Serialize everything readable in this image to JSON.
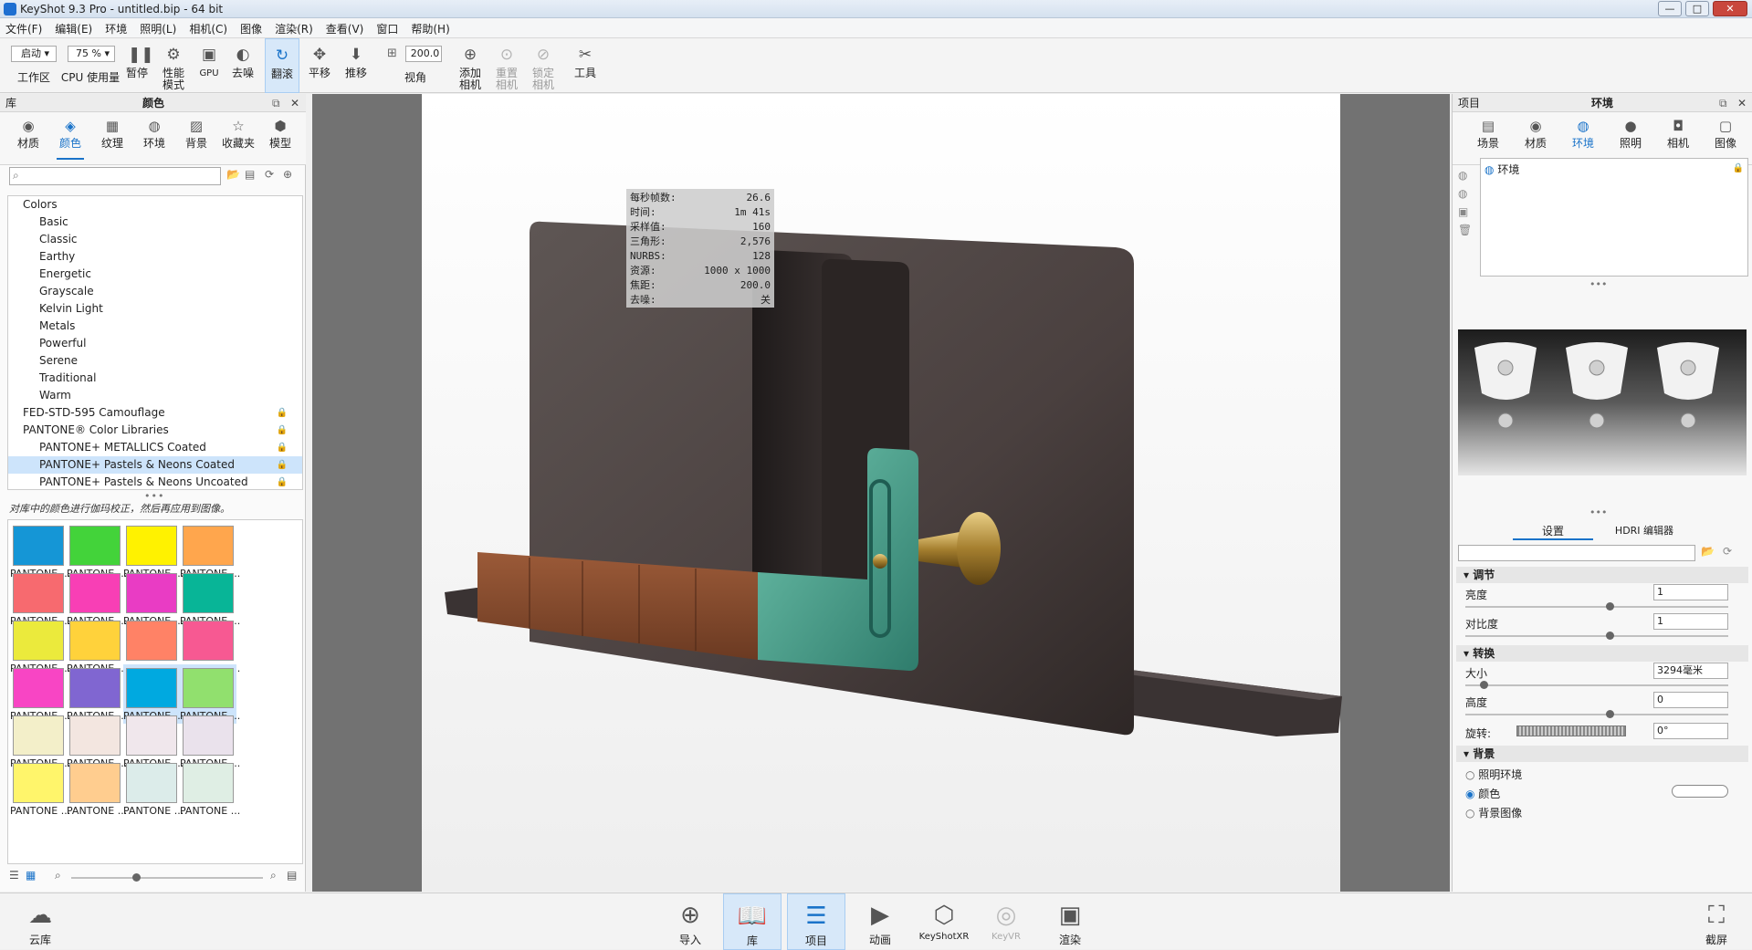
{
  "window": {
    "title": "KeyShot 9.3 Pro  - untitled.bip  - 64 bit",
    "min": "—",
    "max": "□",
    "close": "✕"
  },
  "menu": [
    "文件(F)",
    "编辑(E)",
    "环境",
    "照明(L)",
    "相机(C)",
    "图像",
    "渲染(R)",
    "查看(V)",
    "窗口",
    "帮助(H)"
  ],
  "toolbar": {
    "workspace_select": "启动",
    "workspace_label": "工作区",
    "cpu_select": "75 %",
    "cpu_label": "CPU 使用量",
    "pause": "暂停",
    "perf_mode": "性能\n模式",
    "gpu": "GPU",
    "denoise": "去噪",
    "tumble": "翻滚",
    "pan": "平移",
    "dolly": "推移",
    "fov_value": "200.0",
    "fov_label": "视角",
    "add_camera": "添加\n相机",
    "reset_camera": "重置\n相机",
    "lock_camera": "锁定\n相机",
    "tools": "工具"
  },
  "library": {
    "panel_label": "库",
    "panel_title": "颜色",
    "tabs": [
      "材质",
      "颜色",
      "纹理",
      "环境",
      "背景",
      "收藏夹",
      "模型"
    ],
    "active_tab": "颜色",
    "search_placeholder": "",
    "tree": [
      {
        "label": "Colors",
        "level": 0,
        "locked": false,
        "selected": false
      },
      {
        "label": "Basic",
        "level": 1,
        "locked": false,
        "selected": false
      },
      {
        "label": "Classic",
        "level": 1,
        "locked": false,
        "selected": false
      },
      {
        "label": "Earthy",
        "level": 1,
        "locked": false,
        "selected": false
      },
      {
        "label": "Energetic",
        "level": 1,
        "locked": false,
        "selected": false
      },
      {
        "label": "Grayscale",
        "level": 1,
        "locked": false,
        "selected": false
      },
      {
        "label": "Kelvin Light",
        "level": 1,
        "locked": false,
        "selected": false
      },
      {
        "label": "Metals",
        "level": 1,
        "locked": false,
        "selected": false
      },
      {
        "label": "Powerful",
        "level": 1,
        "locked": false,
        "selected": false
      },
      {
        "label": "Serene",
        "level": 1,
        "locked": false,
        "selected": false
      },
      {
        "label": "Traditional",
        "level": 1,
        "locked": false,
        "selected": false
      },
      {
        "label": "Warm",
        "level": 1,
        "locked": false,
        "selected": false
      },
      {
        "label": "FED-STD-595 Camouflage",
        "level": 0,
        "locked": true,
        "selected": false
      },
      {
        "label": "PANTONE® Color Libraries",
        "level": 0,
        "locked": true,
        "selected": false
      },
      {
        "label": "PANTONE+ METALLICS Coated",
        "level": 1,
        "locked": true,
        "selected": false
      },
      {
        "label": "PANTONE+ Pastels & Neons Coated",
        "level": 1,
        "locked": true,
        "selected": true
      },
      {
        "label": "PANTONE+ Pastels & Neons Uncoated",
        "level": 1,
        "locked": true,
        "selected": false
      }
    ],
    "hint": "对库中的颜色进行伽玛校正，然后再应用到图像。",
    "swatch_label": "PANTONE ...",
    "swatches": [
      "#1596d6",
      "#43d33a",
      "#fff200",
      "#ffa64d",
      "#f76a6f",
      "#f83fb5",
      "#e93cc4",
      "#08b597",
      "#ebea3c",
      "#ffd23b",
      "#ff8266",
      "#f75992",
      "#f845c4",
      "#8066d1",
      "#00a9e0",
      "#91e06e",
      "#f3efc9",
      "#f3e6e0",
      "#f0e7ec",
      "#eae2ec",
      "#fff56b",
      "#ffcd8f",
      "#dcecea",
      "#dfeee4"
    ],
    "selected_swatches": [
      14,
      15
    ]
  },
  "stats": [
    {
      "k": "每秒帧数:",
      "v": "26.6"
    },
    {
      "k": "时间:",
      "v": "1m 41s"
    },
    {
      "k": "采样值:",
      "v": "160"
    },
    {
      "k": "三角形:",
      "v": "2,576"
    },
    {
      "k": "NURBS:",
      "v": "128"
    },
    {
      "k": "资源:",
      "v": "1000 x 1000"
    },
    {
      "k": "焦距:",
      "v": "200.0"
    },
    {
      "k": "去噪:",
      "v": "关"
    }
  ],
  "project": {
    "panel_label": "项目",
    "panel_title": "环境",
    "tabs": [
      "场景",
      "材质",
      "环境",
      "照明",
      "相机",
      "图像"
    ],
    "active_tab": "环境",
    "env_item": "环境",
    "subtabs": {
      "settings": "设置",
      "hdri": "HDRI 编辑器"
    },
    "sections": {
      "adjust": "调节",
      "transform": "转换",
      "background": "背景"
    },
    "fields": {
      "brightness": {
        "label": "亮度",
        "value": "1",
        "level": 0.55
      },
      "contrast": {
        "label": "对比度",
        "value": "1",
        "level": 0.55
      },
      "size": {
        "label": "大小",
        "value": "3294毫米",
        "level": 0.07
      },
      "height": {
        "label": "高度",
        "value": "0",
        "level": 0.55
      },
      "rotation": {
        "label": "旋转:",
        "value": "0°"
      }
    },
    "bg_options": [
      {
        "label": "照明环境",
        "checked": false
      },
      {
        "label": "颜色",
        "checked": true
      },
      {
        "label": "背景图像",
        "checked": false
      }
    ],
    "bg_color": "#ffffff"
  },
  "bottom": {
    "cloud": "云库",
    "buttons": [
      "导入",
      "库",
      "项目",
      "动画",
      "KeyShotXR",
      "KeyVR",
      "渲染"
    ],
    "screenshot": "截屏"
  }
}
